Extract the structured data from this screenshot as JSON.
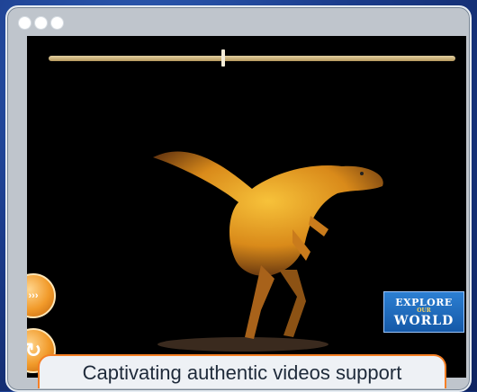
{
  "player": {
    "progress": 0.43,
    "next_icon": "next-icon",
    "replay_icon": "replay-icon"
  },
  "logo": {
    "line1": "EXPLORE",
    "line2": "OUR",
    "line3": "WORLD"
  },
  "caption": "Captivating authentic videos support",
  "colors": {
    "accent": "#f57f25",
    "window": "#bfc5cc",
    "background": "#1b3c8c"
  }
}
